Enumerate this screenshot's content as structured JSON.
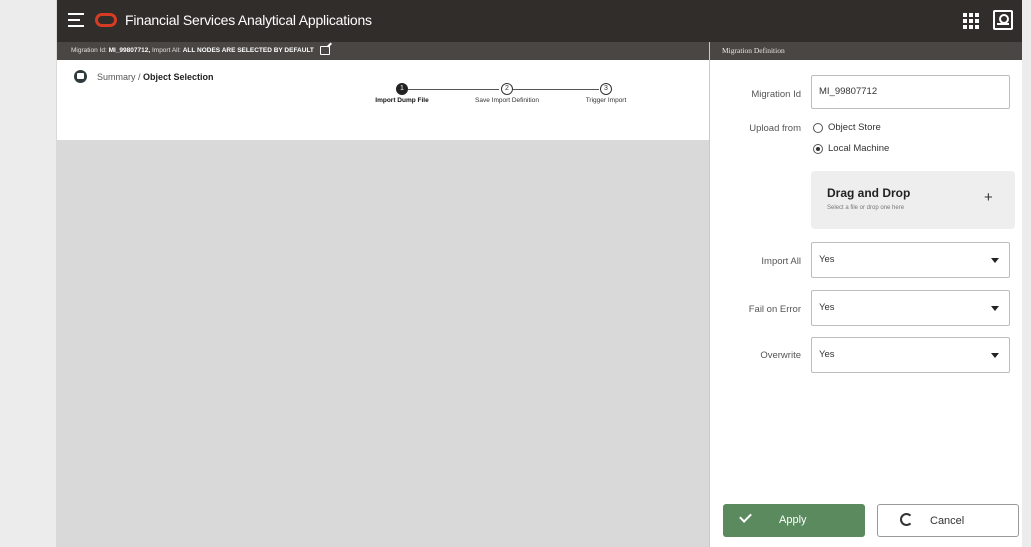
{
  "header": {
    "app_title": "Financial Services Analytical Applications",
    "menu_icon": "hamburger-menu-icon",
    "logo_icon": "oracle-logo-icon",
    "apps_icon": "apps-grid-icon",
    "user_icon": "user-profile-icon",
    "brand_color": "#d63b24",
    "bar_color": "#312d2a"
  },
  "subbar": {
    "migration_prefix": "Migration Id:",
    "migration_id": "MI_99807712,",
    "import_prefix": "Import All:",
    "import_note": "ALL NODES ARE SELECTED BY DEFAULT"
  },
  "breadcrumb": {
    "parent": "Summary",
    "separator": " / ",
    "current": "Object Selection"
  },
  "train": {
    "steps": [
      {
        "number": "1",
        "label": "Import Dump File",
        "active": true
      },
      {
        "number": "2",
        "label": "Save Import Definition",
        "active": false
      },
      {
        "number": "3",
        "label": "Trigger Import",
        "active": false
      }
    ]
  },
  "drawer": {
    "title": "Migration Definition",
    "migration_id_label": "Migration Id",
    "migration_id_value": "MI_99807712",
    "upload_from_label": "Upload from",
    "upload_options": [
      "Object Store",
      "Local Machine"
    ],
    "upload_selected": "Local Machine",
    "dropzone_title": "Drag and Drop",
    "dropzone_sub": "Select a file or drop one here",
    "import_all_label": "Import All",
    "import_all_value": "Yes",
    "fail_on_error_label": "Fail on Error",
    "fail_on_error_value": "Yes",
    "overwrite_label": "Overwrite",
    "overwrite_value": "Yes",
    "apply_label": "Apply",
    "cancel_label": "Cancel",
    "apply_color": "#5a8a5e"
  }
}
